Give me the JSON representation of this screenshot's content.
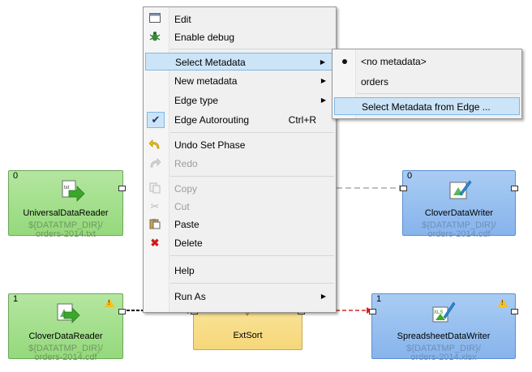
{
  "nodes": {
    "reader1": {
      "phase": "0",
      "title": "UniversalDataReader",
      "line1": "${DATATMP_DIR}/",
      "line2": "orders-2014.txt"
    },
    "writer1": {
      "phase": "0",
      "title": "CloverDataWriter",
      "line1": "${DATATMP_DIR}/",
      "line2": "orders-2014.cdf"
    },
    "reader2": {
      "phase": "1",
      "title": "CloverDataReader",
      "line1": "${DATATMP_DIR}/",
      "line2": "orders-2014.cdf"
    },
    "sort": {
      "title": "ExtSort"
    },
    "writer2": {
      "phase": "1",
      "title": "SpreadsheetDataWriter",
      "line1": "${DATATMP_DIR}/",
      "line2": "orders-2014.xlsx"
    }
  },
  "menu": {
    "edit": "Edit",
    "enable_debug": "Enable debug",
    "select_metadata": "Select Metadata",
    "new_metadata": "New metadata",
    "edge_type": "Edge type",
    "edge_autorouting": "Edge Autorouting",
    "edge_autorouting_shortcut": "Ctrl+R",
    "undo_set_phase": "Undo Set Phase",
    "redo": "Redo",
    "copy": "Copy",
    "cut": "Cut",
    "paste": "Paste",
    "delete": "Delete",
    "help": "Help",
    "run_as": "Run As"
  },
  "submenu": {
    "no_metadata": "<no metadata>",
    "orders": "orders",
    "from_edge": "Select Metadata from Edge ..."
  }
}
